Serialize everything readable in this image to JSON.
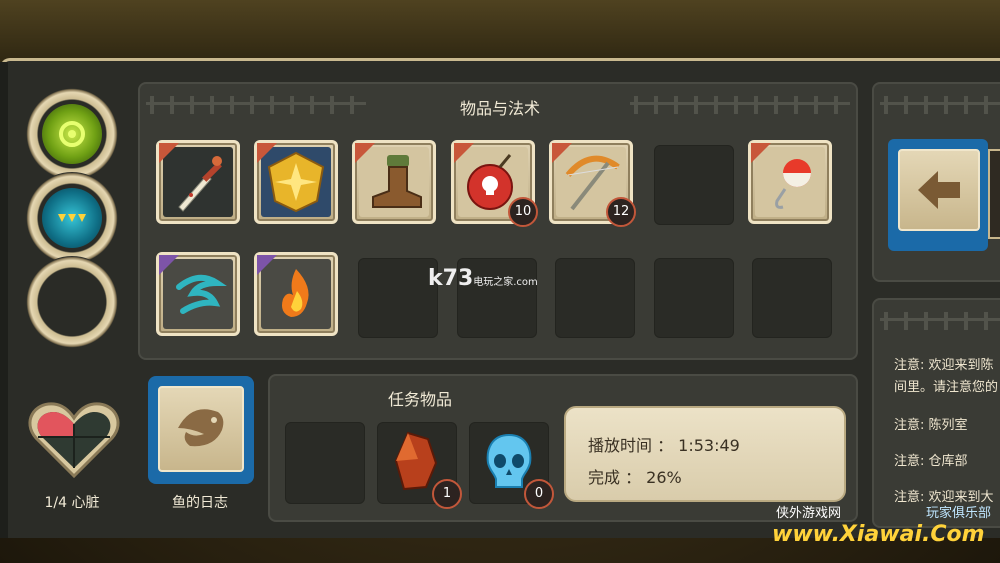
{
  "items_panel": {
    "title": "物品与法术"
  },
  "items": [
    {
      "name": "sword-icon",
      "corner": "orange"
    },
    {
      "name": "golden-shield-icon",
      "corner": "orange"
    },
    {
      "name": "boot-icon",
      "corner": "orange"
    },
    {
      "name": "bomb-icon",
      "corner": "orange",
      "count": "10"
    },
    {
      "name": "crossbow-icon",
      "corner": "orange",
      "count": "12"
    },
    {
      "name": "empty"
    },
    {
      "name": "fishing-bobber-icon",
      "corner": "orange"
    }
  ],
  "spells": [
    {
      "name": "wind-rune-icon",
      "corner": "purple"
    },
    {
      "name": "fire-rune-icon",
      "corner": "purple"
    }
  ],
  "quest_panel": {
    "title": "任务物品"
  },
  "quest_items": [
    {
      "name": "empty"
    },
    {
      "name": "red-crystal-icon",
      "count": "1"
    },
    {
      "name": "crystal-skull-icon",
      "count": "0"
    }
  ],
  "hearts": {
    "label": "1/4 心脏",
    "fraction": 0.25
  },
  "fish_log": {
    "label": "鱼的日志"
  },
  "stats": {
    "playtime": "播放时间 ： 1:53:49",
    "completion": "完成 ： 26%"
  },
  "notes": [
    "注意: 欢迎来到陈",
    "间里。请注意您的",
    "注意: 陈列室",
    "注意: 仓库部",
    "注意: 欢迎来到大"
  ],
  "watermarks": {
    "k73": "k73",
    "k73_sub": "电玩之家",
    "k73_com": ".com",
    "xiawai_cn": "侠外游戏网",
    "xiawai_club": "玩家俱乐部",
    "xiawai_url": "www.Xiawai.Com"
  },
  "colors": {
    "accent_orange": "#c8573a",
    "accent_purple": "#7d54a8",
    "button_blue": "#1b6aa8"
  }
}
